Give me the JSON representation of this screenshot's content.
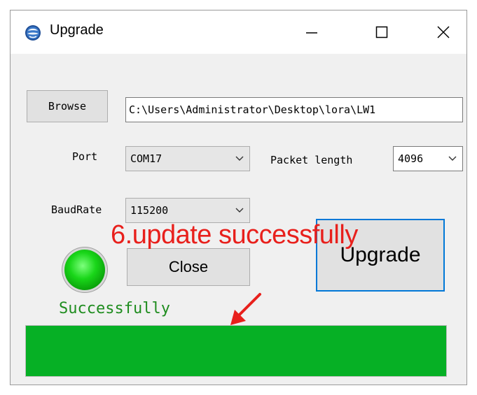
{
  "window": {
    "title": "Upgrade"
  },
  "browse": {
    "label": "Browse",
    "path_value": "C:\\Users\\Administrator\\Desktop\\lora\\LW1"
  },
  "port": {
    "label": "Port",
    "selected": "COM17"
  },
  "packet_length": {
    "label": "Packet length",
    "selected": "4096"
  },
  "baudrate": {
    "label": "BaudRate",
    "selected": "115200"
  },
  "buttons": {
    "close_label": "Close",
    "upgrade_label": "Upgrade"
  },
  "annotation": {
    "text": "6.update successfully"
  },
  "status": {
    "text": "Successfully",
    "progress_percent": 100,
    "led_color": "#19d619"
  },
  "colors": {
    "progress_fill": "#06b025",
    "annotation": "#e8201c",
    "status_text": "#1e8c1e",
    "focus_border": "#0078d7"
  },
  "icons": {
    "app": "app-globe-icon",
    "minimize": "minimize-icon",
    "maximize": "maximize-icon",
    "close": "close-icon",
    "dropdown": "chevron-down-icon",
    "annotation_arrow": "arrow-icon"
  }
}
